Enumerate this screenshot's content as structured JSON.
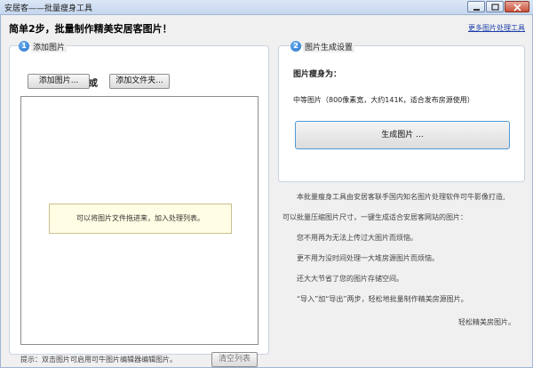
{
  "window": {
    "title": "安居客——批量瘦身工具",
    "controls": [
      "minimize-icon",
      "maximize-icon",
      "close-icon"
    ]
  },
  "header": {
    "headline": "简单2步，批量制作精美安居客图片！",
    "more_link": "更多图片处理工具"
  },
  "step1": {
    "number": "1",
    "title": "添加图片",
    "add_image_button": "添加图片...",
    "or_text": "或",
    "add_folder_button": "添加文件夹...",
    "drop_hint": "可以将图片文件拖进来，加入处理列表。",
    "tip": "提示：双击图片可启用可牛图片编辑器编辑图片。",
    "clear_button": "清空列表"
  },
  "step2": {
    "number": "2",
    "title": "图片生成设置",
    "slim_label": "图片瘦身为：",
    "slim_value": "中等图片（800像素宽，大约141K，适合发布房源使用）",
    "generate_button": "生成图片 ..."
  },
  "description": {
    "lines": [
      "本批量瘦身工具由安居客联手国内知名图片处理软件可牛影像打造,",
      "可以批量压缩图片尺寸，一键生成适合安居客网站的图片：",
      "您不用再为无法上传过大图片而烦恼。",
      "更不用为没时间处理一大堆房源图片而烦恼。",
      "还大大节省了您的图片存储空间。",
      "“导入”加“导出”两步，轻松地批量制作精美房源图片。"
    ],
    "closing": "轻松精美房图片。"
  },
  "colors": {
    "accent": "#1f6fc9",
    "link": "#1c3ea8",
    "hint_bg": "#fffde3",
    "generate_border": "#4f9ad8"
  }
}
